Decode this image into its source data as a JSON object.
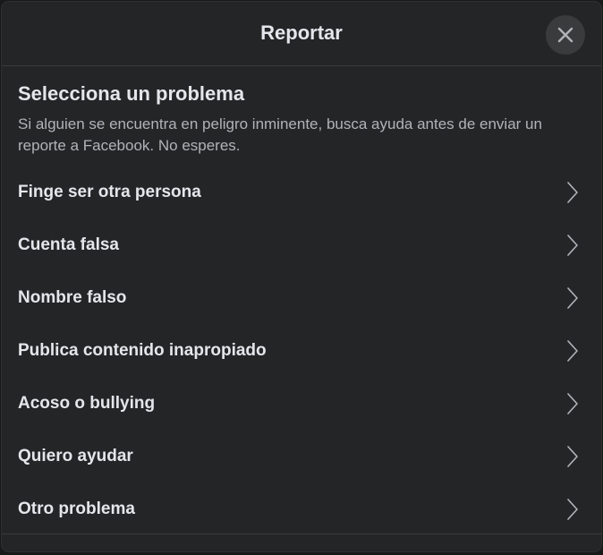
{
  "dialog": {
    "title": "Reportar",
    "close_icon": "close-icon"
  },
  "content": {
    "heading": "Selecciona un problema",
    "description": "Si alguien se encuentra en peligro inminente, busca ayuda antes de enviar un reporte a Facebook. No esperes."
  },
  "options": [
    {
      "label": "Finge ser otra persona",
      "icon": "chevron-right-icon"
    },
    {
      "label": "Cuenta falsa",
      "icon": "chevron-right-icon"
    },
    {
      "label": "Nombre falso",
      "icon": "chevron-right-icon"
    },
    {
      "label": "Publica contenido inapropiado",
      "icon": "chevron-right-icon"
    },
    {
      "label": "Acoso o bullying",
      "icon": "chevron-right-icon"
    },
    {
      "label": "Quiero ayudar",
      "icon": "chevron-right-icon"
    },
    {
      "label": "Otro problema",
      "icon": "chevron-right-icon"
    }
  ],
  "colors": {
    "background": "#242526",
    "text_primary": "#e4e6eb",
    "text_secondary": "#b0b3b8",
    "divider": "#3a3b3c"
  }
}
